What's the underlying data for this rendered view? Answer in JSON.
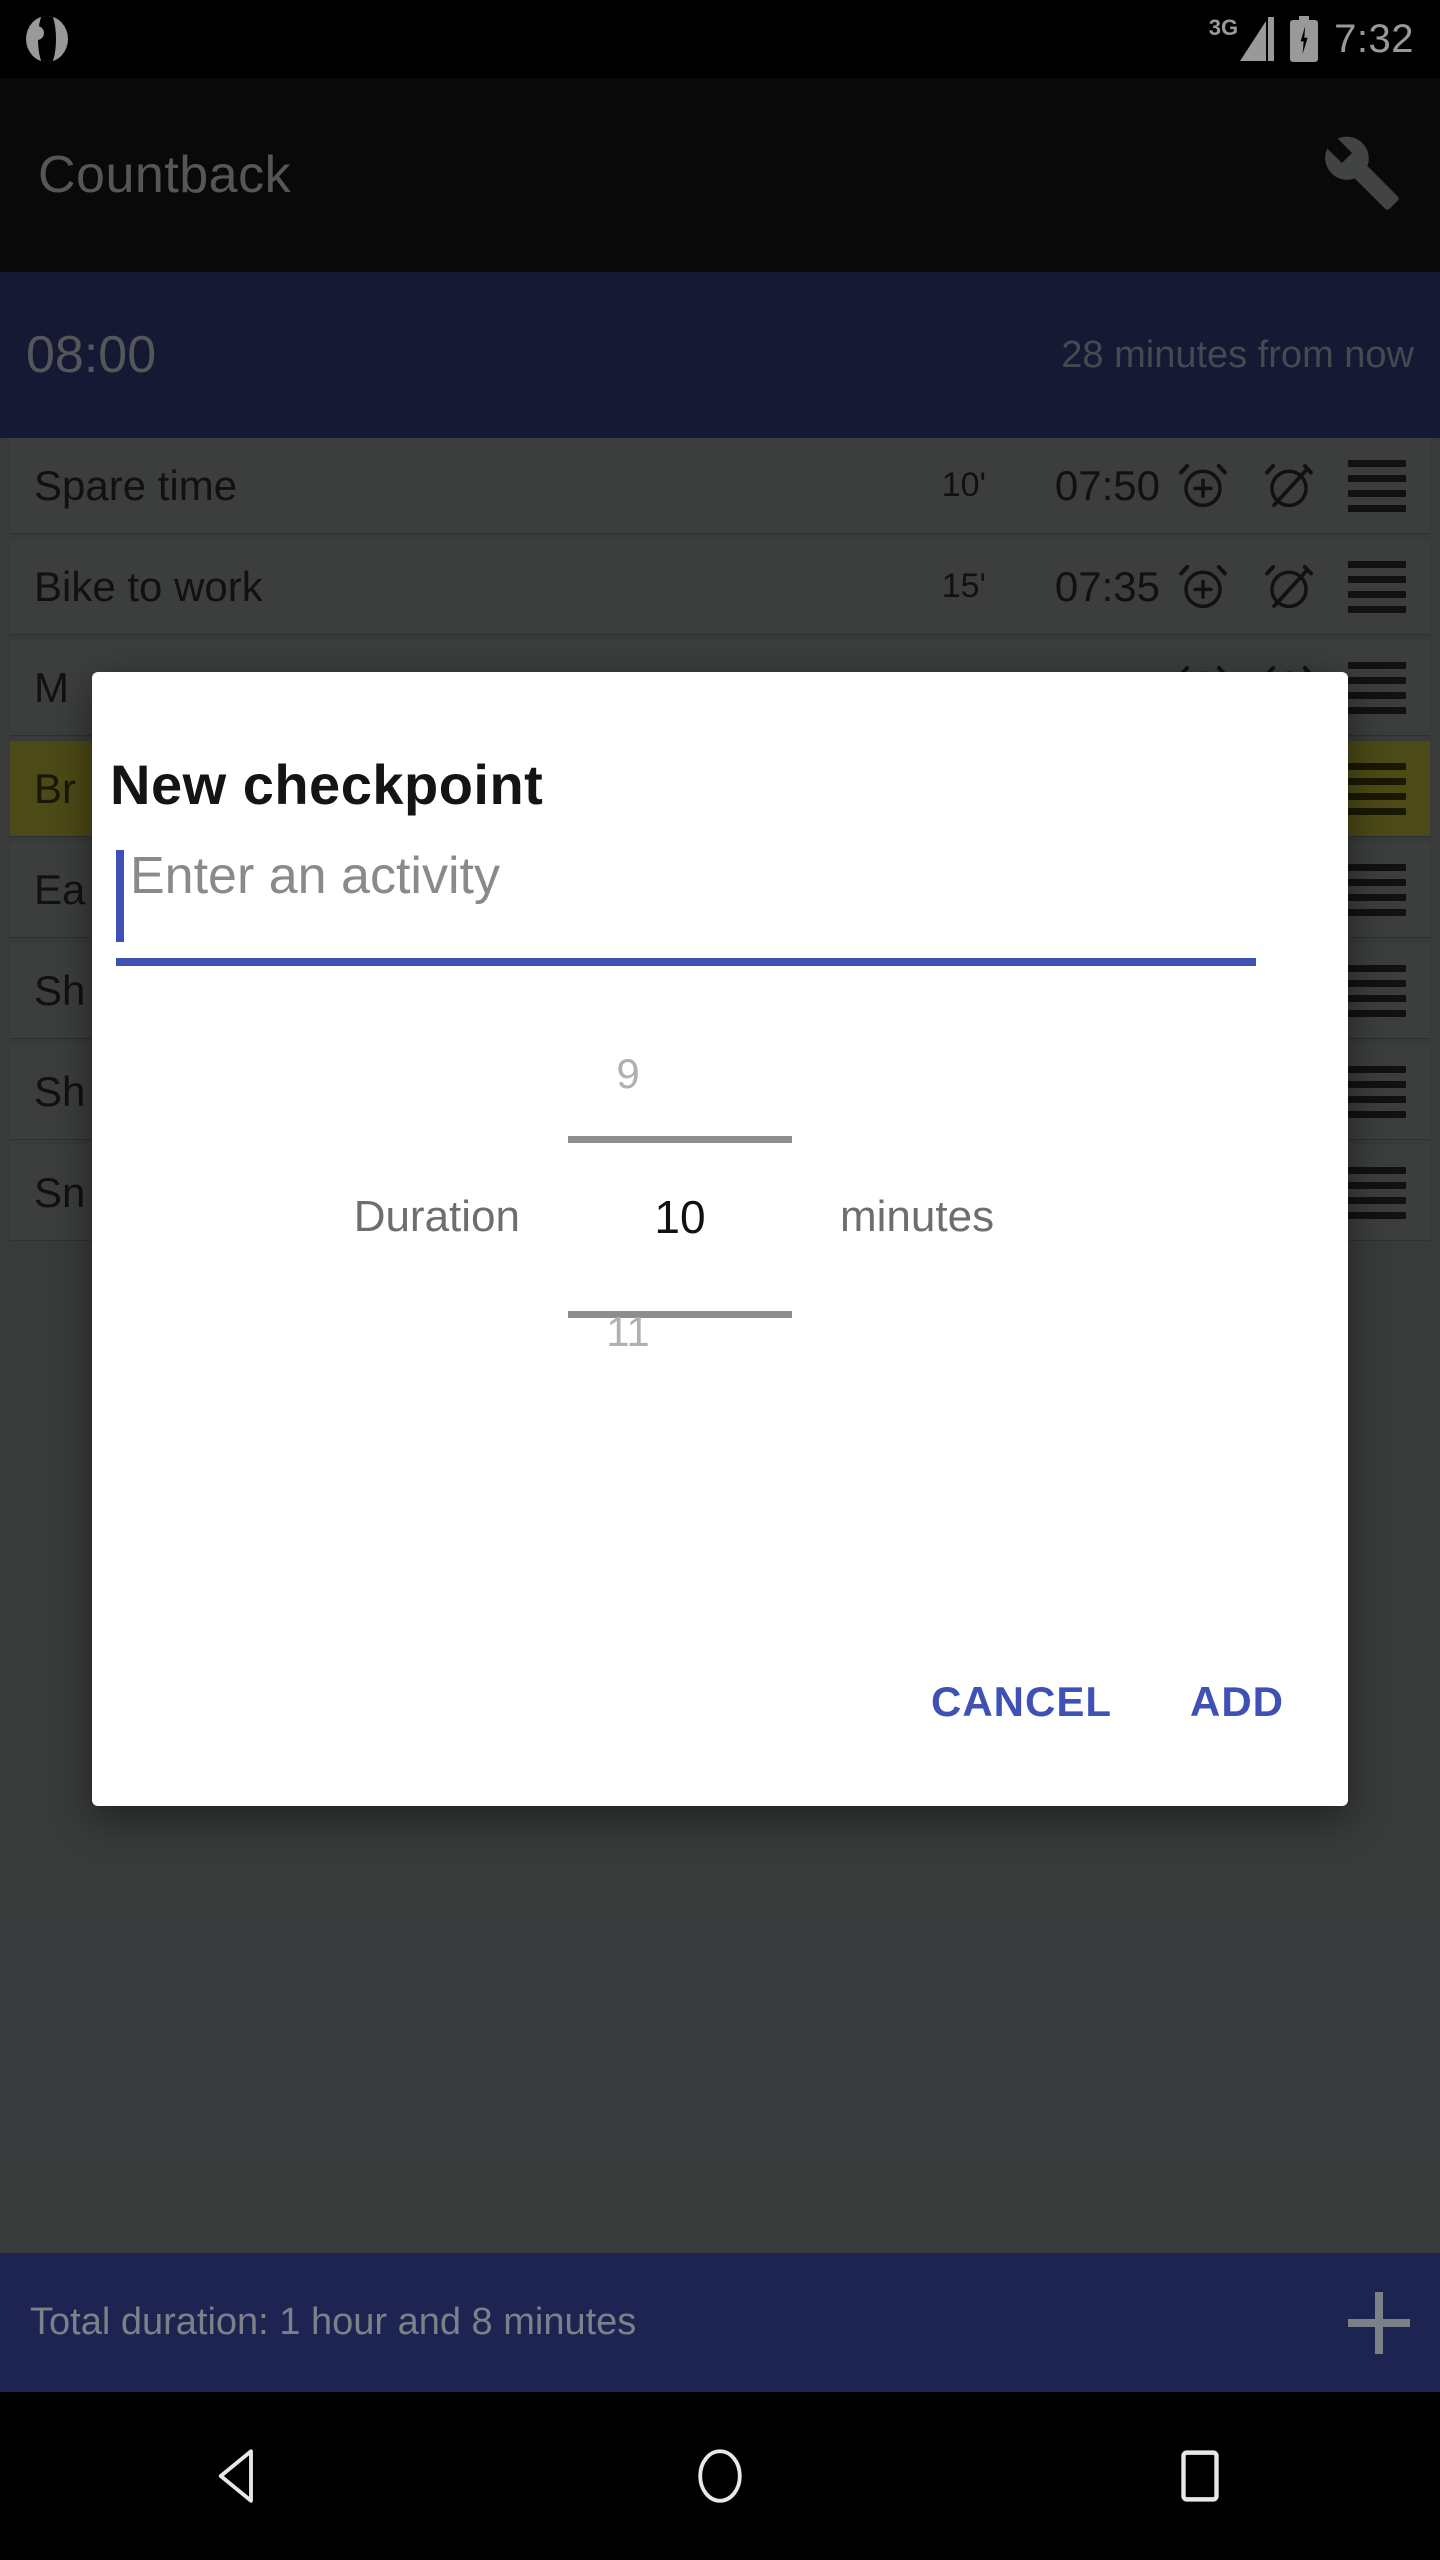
{
  "status_bar": {
    "notification_icon": "globe-icon",
    "network_type": "3G",
    "signal_icon": "signal-icon",
    "battery_icon": "battery-charging-icon",
    "clock": "7:32"
  },
  "app_bar": {
    "title": "Countback",
    "settings_icon": "wrench-icon"
  },
  "target": {
    "time": "08:00",
    "note": "28 minutes from now"
  },
  "list": {
    "rows": [
      {
        "name": "Spare time",
        "duration": "10'",
        "time": "07:50",
        "highlight": false,
        "truncated": false
      },
      {
        "name": "Bike to work",
        "duration": "15'",
        "time": "07:35",
        "highlight": false,
        "truncated": false
      },
      {
        "name": "M",
        "duration": "",
        "time": "",
        "highlight": false,
        "truncated": true
      },
      {
        "name": "Br",
        "duration": "",
        "time": "",
        "highlight": true,
        "truncated": true
      },
      {
        "name": "Ea",
        "duration": "",
        "time": "",
        "highlight": false,
        "truncated": true
      },
      {
        "name": "Sh",
        "duration": "",
        "time": "",
        "highlight": false,
        "truncated": true
      },
      {
        "name": "Sh",
        "duration": "",
        "time": "",
        "highlight": false,
        "truncated": true
      },
      {
        "name": "Sn",
        "duration": "",
        "time": "",
        "highlight": false,
        "truncated": true
      }
    ],
    "row_icons": {
      "alarm_add": "alarm-add-icon",
      "alarm_off": "alarm-off-icon",
      "drag": "drag-handle-icon"
    }
  },
  "dialog": {
    "title": "New checkpoint",
    "activity_input": {
      "value": "",
      "placeholder": "Enter an activity"
    },
    "duration_picker": {
      "label": "Duration",
      "unit": "minutes",
      "previous_value": "9",
      "value": "10",
      "next_value": "11"
    },
    "cancel_label": "CANCEL",
    "add_label": "ADD"
  },
  "bottom_bar": {
    "total_duration": "Total duration: 1 hour and 8 minutes",
    "add_icon": "plus-icon"
  },
  "nav_bar": {
    "back_icon": "back-triangle-icon",
    "home_icon": "home-circle-icon",
    "recents_icon": "recents-square-icon"
  },
  "colors": {
    "accent": "#3f51b5",
    "app_bar": "#101010",
    "target_bar": "#232a57",
    "bottom_bar": "#1d2452",
    "row": "#636866",
    "row_highlight": "#7f7c26"
  }
}
